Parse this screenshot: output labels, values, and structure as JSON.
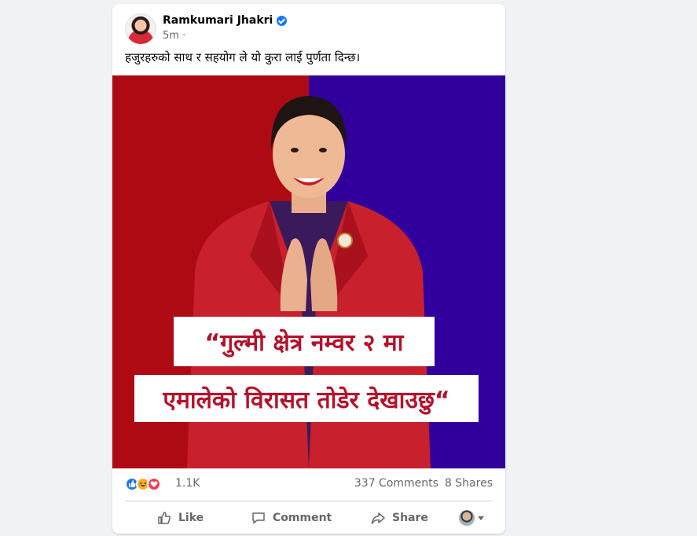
{
  "post": {
    "author": "Ramkumari Jhakri",
    "verified": true,
    "time": "5m ·",
    "caption": "हजुरहरुको साथ र सहयोग ले यो कुरा लाई पुर्णता दिन्छ।",
    "media": {
      "quote_line_1": "“गुल्मी क्षेत्र नम्वर २ मा",
      "quote_line_2": "एमालेको विरासत तोडेर देखाउछु“",
      "colors": {
        "left_panel": "#ad0a14",
        "right_panel": "#31009c",
        "quote_text": "#b5112b"
      }
    }
  },
  "stats": {
    "reaction_icons": [
      "like-icon",
      "haha-icon",
      "love-icon"
    ],
    "reaction_count": "1.1K",
    "comments": "337 Comments",
    "shares": "8 Shares"
  },
  "actions": {
    "like": "Like",
    "comment": "Comment",
    "share": "Share"
  },
  "colors": {
    "accent": "#1877f2",
    "muted_text": "#65676b",
    "background": "#f0f2f5"
  }
}
